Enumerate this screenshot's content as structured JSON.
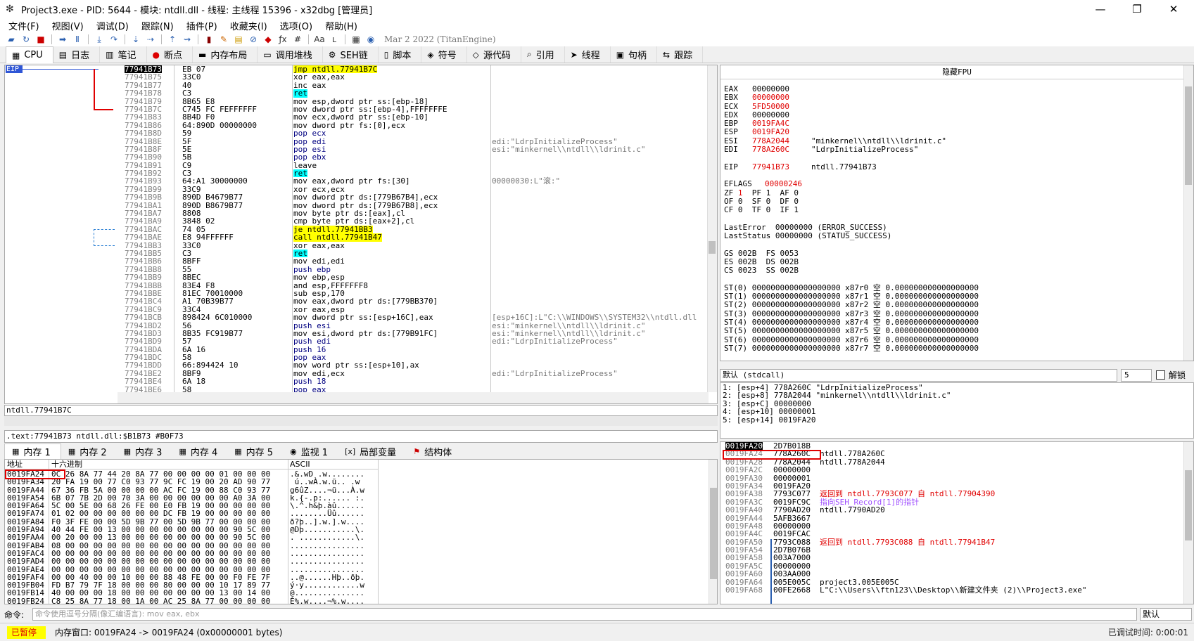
{
  "window": {
    "title": "Project3.exe - PID: 5644 - 模块: ntdll.dll - 线程: 主线程 15396 - x32dbg [管理员]",
    "subtitle": "Mar 2 2022 (TitanEngine)"
  },
  "menu": [
    "文件(F)",
    "视图(V)",
    "调试(D)",
    "跟踪(N)",
    "插件(P)",
    "收藏夹(I)",
    "选项(O)",
    "帮助(H)"
  ],
  "toolbar": {
    "date": "Mar 2 2022 (TitanEngine)"
  },
  "tabs": [
    {
      "label": "CPU",
      "icon": "cpu-icon"
    },
    {
      "label": "日志",
      "icon": "log-icon"
    },
    {
      "label": "笔记",
      "icon": "notes-icon"
    },
    {
      "label": "断点",
      "icon": "breakpoint-icon"
    },
    {
      "label": "内存布局",
      "icon": "memory-map-icon"
    },
    {
      "label": "调用堆栈",
      "icon": "callstack-icon"
    },
    {
      "label": "SEH链",
      "icon": "seh-icon"
    },
    {
      "label": "脚本",
      "icon": "script-icon"
    },
    {
      "label": "符号",
      "icon": "symbol-icon"
    },
    {
      "label": "源代码",
      "icon": "source-icon"
    },
    {
      "label": "引用",
      "icon": "reference-icon"
    },
    {
      "label": "线程",
      "icon": "thread-icon"
    },
    {
      "label": "句柄",
      "icon": "handle-icon"
    },
    {
      "label": "跟踪",
      "icon": "trace-icon"
    }
  ],
  "disasm": {
    "eip_label": "EIP",
    "rows": [
      {
        "addr": "77941B73",
        "bytes": "EB 07",
        "ins": "jmp ntdll.77941B7C",
        "cmt": ""
      },
      {
        "addr": "77941B75",
        "bytes": "33C0",
        "ins": "xor eax,eax",
        "cmt": ""
      },
      {
        "addr": "77941B77",
        "bytes": "40",
        "ins": "inc eax",
        "cmt": ""
      },
      {
        "addr": "77941B78",
        "bytes": "C3",
        "ins": "ret",
        "cmt": ""
      },
      {
        "addr": "77941B79",
        "bytes": "8B65 E8",
        "ins": "mov esp,dword ptr ss:[ebp-18]",
        "cmt": ""
      },
      {
        "addr": "77941B7C",
        "bytes": "C745 FC FEFFFFFF",
        "ins": "mov dword ptr ss:[ebp-4],FFFFFFFE",
        "cmt": ""
      },
      {
        "addr": "77941B83",
        "bytes": "8B4D F0",
        "ins": "mov ecx,dword ptr ss:[ebp-10]",
        "cmt": ""
      },
      {
        "addr": "77941B86",
        "bytes": "64:890D 00000000",
        "ins": "mov dword ptr fs:[0],ecx",
        "cmt": ""
      },
      {
        "addr": "77941B8D",
        "bytes": "59",
        "ins": "pop ecx",
        "cmt": ""
      },
      {
        "addr": "77941B8E",
        "bytes": "5F",
        "ins": "pop edi",
        "cmt": "edi:\"LdrpInitializeProcess\""
      },
      {
        "addr": "77941B8F",
        "bytes": "5E",
        "ins": "pop esi",
        "cmt": "esi:\"minkernel\\\\ntdll\\\\ldrinit.c\""
      },
      {
        "addr": "77941B90",
        "bytes": "5B",
        "ins": "pop ebx",
        "cmt": ""
      },
      {
        "addr": "77941B91",
        "bytes": "C9",
        "ins": "leave",
        "cmt": ""
      },
      {
        "addr": "77941B92",
        "bytes": "C3",
        "ins": "ret",
        "cmt": ""
      },
      {
        "addr": "77941B93",
        "bytes": "64:A1 30000000",
        "ins": "mov eax,dword ptr fs:[30]",
        "cmt": "00000030:L\"滚:\""
      },
      {
        "addr": "77941B99",
        "bytes": "33C9",
        "ins": "xor ecx,ecx",
        "cmt": ""
      },
      {
        "addr": "77941B9B",
        "bytes": "890D B4679B77",
        "ins": "mov dword ptr ds:[779B67B4],ecx",
        "cmt": ""
      },
      {
        "addr": "77941BA1",
        "bytes": "890D B8679B77",
        "ins": "mov dword ptr ds:[779B67B8],ecx",
        "cmt": ""
      },
      {
        "addr": "77941BA7",
        "bytes": "8808",
        "ins": "mov byte ptr ds:[eax],cl",
        "cmt": ""
      },
      {
        "addr": "77941BA9",
        "bytes": "3848 02",
        "ins": "cmp byte ptr ds:[eax+2],cl",
        "cmt": ""
      },
      {
        "addr": "77941BAC",
        "bytes": "74 05",
        "ins": "je ntdll.77941BB3",
        "cmt": ""
      },
      {
        "addr": "77941BAE",
        "bytes": "E8 94FFFFFF",
        "ins": "call ntdll.77941B47",
        "cmt": ""
      },
      {
        "addr": "77941BB3",
        "bytes": "33C0",
        "ins": "xor eax,eax",
        "cmt": ""
      },
      {
        "addr": "77941BB5",
        "bytes": "C3",
        "ins": "ret",
        "cmt": ""
      },
      {
        "addr": "77941BB6",
        "bytes": "8BFF",
        "ins": "mov edi,edi",
        "cmt": ""
      },
      {
        "addr": "77941BB8",
        "bytes": "55",
        "ins": "push ebp",
        "cmt": ""
      },
      {
        "addr": "77941BB9",
        "bytes": "8BEC",
        "ins": "mov ebp,esp",
        "cmt": ""
      },
      {
        "addr": "77941BBB",
        "bytes": "83E4 F8",
        "ins": "and esp,FFFFFFF8",
        "cmt": ""
      },
      {
        "addr": "77941BBE",
        "bytes": "81EC 70010000",
        "ins": "sub esp,170",
        "cmt": ""
      },
      {
        "addr": "77941BC4",
        "bytes": "A1 70B39B77",
        "ins": "mov eax,dword ptr ds:[779BB370]",
        "cmt": ""
      },
      {
        "addr": "77941BC9",
        "bytes": "33C4",
        "ins": "xor eax,esp",
        "cmt": ""
      },
      {
        "addr": "77941BCB",
        "bytes": "898424 6C010000",
        "ins": "mov dword ptr ss:[esp+16C],eax",
        "cmt": "[esp+16C]:L\"C:\\\\WINDOWS\\\\SYSTEM32\\\\ntdll.dll"
      },
      {
        "addr": "77941BD2",
        "bytes": "56",
        "ins": "push esi",
        "cmt": "esi:\"minkernel\\\\ntdll\\\\ldrinit.c\""
      },
      {
        "addr": "77941BD3",
        "bytes": "8B35 FC919B77",
        "ins": "mov esi,dword ptr ds:[779B91FC]",
        "cmt": "esi:\"minkernel\\\\ntdll\\\\ldrinit.c\""
      },
      {
        "addr": "77941BD9",
        "bytes": "57",
        "ins": "push edi",
        "cmt": "edi:\"LdrpInitializeProcess\""
      },
      {
        "addr": "77941BDA",
        "bytes": "6A 16",
        "ins": "push 16",
        "cmt": ""
      },
      {
        "addr": "77941BDC",
        "bytes": "58",
        "ins": "pop eax",
        "cmt": ""
      },
      {
        "addr": "77941BDD",
        "bytes": "66:894424 10",
        "ins": "mov word ptr ss:[esp+10],ax",
        "cmt": ""
      },
      {
        "addr": "77941BE2",
        "bytes": "8BF9",
        "ins": "mov edi,ecx",
        "cmt": "edi:\"LdrpInitializeProcess\""
      },
      {
        "addr": "77941BE4",
        "bytes": "6A 18",
        "ins": "push 18",
        "cmt": ""
      },
      {
        "addr": "77941BE6",
        "bytes": "58",
        "ins": "pop eax",
        "cmt": ""
      }
    ]
  },
  "info": {
    "line1": "ntdll.77941B7C",
    "line2": ".text:77941B73 ntdll.dll:$B1B73 #B0F73"
  },
  "fpu": {
    "header": "隐藏FPU",
    "regs": [
      {
        "name": "EAX",
        "val": "00000000",
        "cmt": "",
        "red": false
      },
      {
        "name": "EBX",
        "val": "00000000",
        "cmt": "",
        "red": true
      },
      {
        "name": "ECX",
        "val": "5FD50000",
        "cmt": "",
        "red": true
      },
      {
        "name": "EDX",
        "val": "00000000",
        "cmt": "",
        "red": false
      },
      {
        "name": "EBP",
        "val": "0019FA4C",
        "cmt": "",
        "red": true
      },
      {
        "name": "ESP",
        "val": "0019FA20",
        "cmt": "",
        "red": true
      },
      {
        "name": "ESI",
        "val": "778A2044",
        "cmt": "\"minkernel\\\\ntdll\\\\ldrinit.c\"",
        "red": true
      },
      {
        "name": "EDI",
        "val": "778A260C",
        "cmt": "\"LdrpInitializeProcess\"",
        "red": true
      }
    ],
    "eip": {
      "name": "EIP",
      "val": "77941B73",
      "cmt": "ntdll.77941B73"
    },
    "eflags": {
      "name": "EFLAGS",
      "val": "00000246"
    },
    "flags": [
      "ZF 1  PF 1  AF 0",
      "OF 0  SF 0  DF 0",
      "CF 0  TF 0  IF 1"
    ],
    "lasterror": "LastError  00000000 (ERROR_SUCCESS)",
    "laststatus": "LastStatus 00000000 (STATUS_SUCCESS)",
    "segs": [
      "GS 002B  FS 0053",
      "ES 002B  DS 002B",
      "CS 0023  SS 002B"
    ],
    "st": [
      "ST(0) 0000000000000000000 x87r0 空 0.000000000000000000",
      "ST(1) 0000000000000000000 x87r1 空 0.000000000000000000",
      "ST(2) 0000000000000000000 x87r2 空 0.000000000000000000",
      "ST(3) 0000000000000000000 x87r3 空 0.000000000000000000",
      "ST(4) 0000000000000000000 x87r4 空 0.000000000000000000",
      "ST(5) 0000000000000000000 x87r5 空 0.000000000000000000",
      "ST(6) 0000000000000000000 x87r6 空 0.000000000000000000",
      "ST(7) 0000000000000000000 x87r7 空 0.000000000000000000"
    ]
  },
  "callconv": {
    "selected": "默认 (stdcall)",
    "count": "5",
    "unlock": "解锁"
  },
  "callstack": [
    "1: [esp+4] 778A260C \"LdrpInitializeProcess\"",
    "2: [esp+8] 778A2044 \"minkernel\\\\ntdll\\\\ldrinit.c\"",
    "3: [esp+C] 00000000",
    "4: [esp+10] 00000001",
    "5: [esp+14] 0019FA20"
  ],
  "dumptabs": [
    {
      "label": "内存 1",
      "icon": "memory-icon"
    },
    {
      "label": "内存 2",
      "icon": "memory-icon"
    },
    {
      "label": "内存 3",
      "icon": "memory-icon"
    },
    {
      "label": "内存 4",
      "icon": "memory-icon"
    },
    {
      "label": "内存 5",
      "icon": "memory-icon"
    },
    {
      "label": "监视 1",
      "icon": "watch-icon"
    },
    {
      "label": "局部变量",
      "icon": "locals-icon"
    },
    {
      "label": "结构体",
      "icon": "struct-icon"
    }
  ],
  "dump": {
    "headers": {
      "addr": "地址",
      "hex": "十六进制",
      "ascii": "ASCII"
    },
    "rows": [
      {
        "addr": "0019FA24",
        "hex": "0C 26 8A 77 44 20 8A 77 00 00 00 00 01 00 00 00",
        "ascii": ".&.wD .w........"
      },
      {
        "addr": "0019FA34",
        "hex": "20 FA 19 00 77 C0 93 77 9C FC 19 00 20 AD 90 77",
        "ascii": " ú..wÀ.w.ü.. .w"
      },
      {
        "addr": "0019FA44",
        "hex": "67 36 FB 5A 00 00 00 00 AC FC 19 00 88 C0 93 77",
        "ascii": "g6ûZ....¬ü...À.w"
      },
      {
        "addr": "0019FA54",
        "hex": "6B 07 7B 2D 00 70 3A 00 00 00 00 00 00 A0 3A 00",
        "ascii": "k.{-.p:...... :."
      },
      {
        "addr": "0019FA64",
        "hex": "5C 00 5E 00 68 26 FE 00 E0 FB 19 00 00 00 00 00",
        "ascii": "\\.^.h&þ.àû......"
      },
      {
        "addr": "0019FA74",
        "hex": "01 02 00 00 00 00 00 00 DC FB 19 00 00 00 00 00",
        "ascii": "........Üû......"
      },
      {
        "addr": "0019FA84",
        "hex": "F0 3F FE 00 00 5D 9B 77 00 5D 9B 77 00 00 00 00",
        "ascii": "ð?þ..].w.].w...."
      },
      {
        "addr": "0019FA94",
        "hex": "40 44 FE 00 13 00 00 00 00 00 00 00 00 90 5C 00",
        "ascii": "@Dþ...........\\."
      },
      {
        "addr": "0019FAA4",
        "hex": "00 20 00 00 13 00 00 00 00 00 00 00 00 90 5C 00",
        "ascii": ". ............\\."
      },
      {
        "addr": "0019FAB4",
        "hex": "08 00 00 00 00 00 00 00 00 00 00 00 00 00 00 00",
        "ascii": "................"
      },
      {
        "addr": "0019FAC4",
        "hex": "00 00 00 00 00 00 00 00 00 00 00 00 00 00 00 00",
        "ascii": "................"
      },
      {
        "addr": "0019FAD4",
        "hex": "00 00 00 00 00 00 00 00 00 00 00 00 00 00 00 00",
        "ascii": "................"
      },
      {
        "addr": "0019FAE4",
        "hex": "00 00 00 00 00 00 00 00 00 00 00 00 00 00 00 00",
        "ascii": "................"
      },
      {
        "addr": "0019FAF4",
        "hex": "00 00 40 00 00 10 00 00 88 48 FE 00 00 F0 FE 7F",
        "ascii": "..@......Hþ..ðþ."
      },
      {
        "addr": "0019FB04",
        "hex": "FD B7 79 7F 18 00 00 00 80 00 00 00 10 17 89 77",
        "ascii": "ý·y............w"
      },
      {
        "addr": "0019FB14",
        "hex": "40 00 00 00 18 00 00 00 00 00 00 00 13 00 14 00",
        "ascii": "@..............."
      },
      {
        "addr": "0019FB24",
        "hex": "C8 25 8A 77 18 00 1A 00 AC 25 8A 77 00 00 00 00",
        "ascii": "È%.w....¬%.w...."
      }
    ]
  },
  "stack": [
    {
      "addr": "0019FA20",
      "val": "2D7B018B",
      "cmt": "",
      "red": false,
      "top": true
    },
    {
      "addr": "0019FA24",
      "val": "778A260C",
      "cmt": "ntdll.778A260C",
      "red": false,
      "top": false
    },
    {
      "addr": "0019FA28",
      "val": "778A2044",
      "cmt": "ntdll.778A2044",
      "red": false,
      "top": false
    },
    {
      "addr": "0019FA2C",
      "val": "00000000",
      "cmt": "",
      "red": false,
      "top": false
    },
    {
      "addr": "0019FA30",
      "val": "00000001",
      "cmt": "",
      "red": false,
      "top": false
    },
    {
      "addr": "0019FA34",
      "val": "0019FA20",
      "cmt": "",
      "red": false,
      "top": false
    },
    {
      "addr": "0019FA38",
      "val": "7793C077",
      "cmt": "返回到 ntdll.7793C077 自 ntdll.77904390",
      "red": true,
      "top": false
    },
    {
      "addr": "0019FA3C",
      "val": "0019FC9C",
      "cmt": "指向SEH_Record[1]的指针",
      "red": false,
      "top": false,
      "purple": true
    },
    {
      "addr": "0019FA40",
      "val": "7790AD20",
      "cmt": "ntdll.7790AD20",
      "red": false,
      "top": false
    },
    {
      "addr": "0019FA44",
      "val": "5AFB3667",
      "cmt": "",
      "red": false,
      "top": false
    },
    {
      "addr": "0019FA48",
      "val": "00000000",
      "cmt": "",
      "red": false,
      "top": false
    },
    {
      "addr": "0019FA4C",
      "val": "0019FCAC",
      "cmt": "",
      "red": false,
      "top": false
    },
    {
      "addr": "0019FA50",
      "val": "7793C088",
      "cmt": "返回到 ntdll.7793C088 自 ntdll.77941B47",
      "red": true,
      "top": false
    },
    {
      "addr": "0019FA54",
      "val": "2D7B076B",
      "cmt": "",
      "red": false,
      "top": false
    },
    {
      "addr": "0019FA58",
      "val": "003A7000",
      "cmt": "",
      "red": false,
      "top": false
    },
    {
      "addr": "0019FA5C",
      "val": "00000000",
      "cmt": "",
      "red": false,
      "top": false
    },
    {
      "addr": "0019FA60",
      "val": "003AA000",
      "cmt": "",
      "red": false,
      "top": false
    },
    {
      "addr": "0019FA64",
      "val": "005E005C",
      "cmt": "project3.005E005C",
      "red": false,
      "top": false
    },
    {
      "addr": "0019FA68",
      "val": "00FE2668",
      "cmt": "L\"C:\\\\Users\\\\ftn123\\\\Desktop\\\\新建文件夹 (2)\\\\Project3.exe\"",
      "red": false,
      "top": false
    }
  ],
  "command": {
    "label": "命令:",
    "placeholder": "命令使用逗号分隔(像汇编语言): mov eax, ebx",
    "dropdown": "默认"
  },
  "status": {
    "paused": "已暂停",
    "message": "内存窗口: 0019FA24 -> 0019FA24 (0x00000001 bytes)",
    "right": "已调试时间: 0:00:01"
  }
}
